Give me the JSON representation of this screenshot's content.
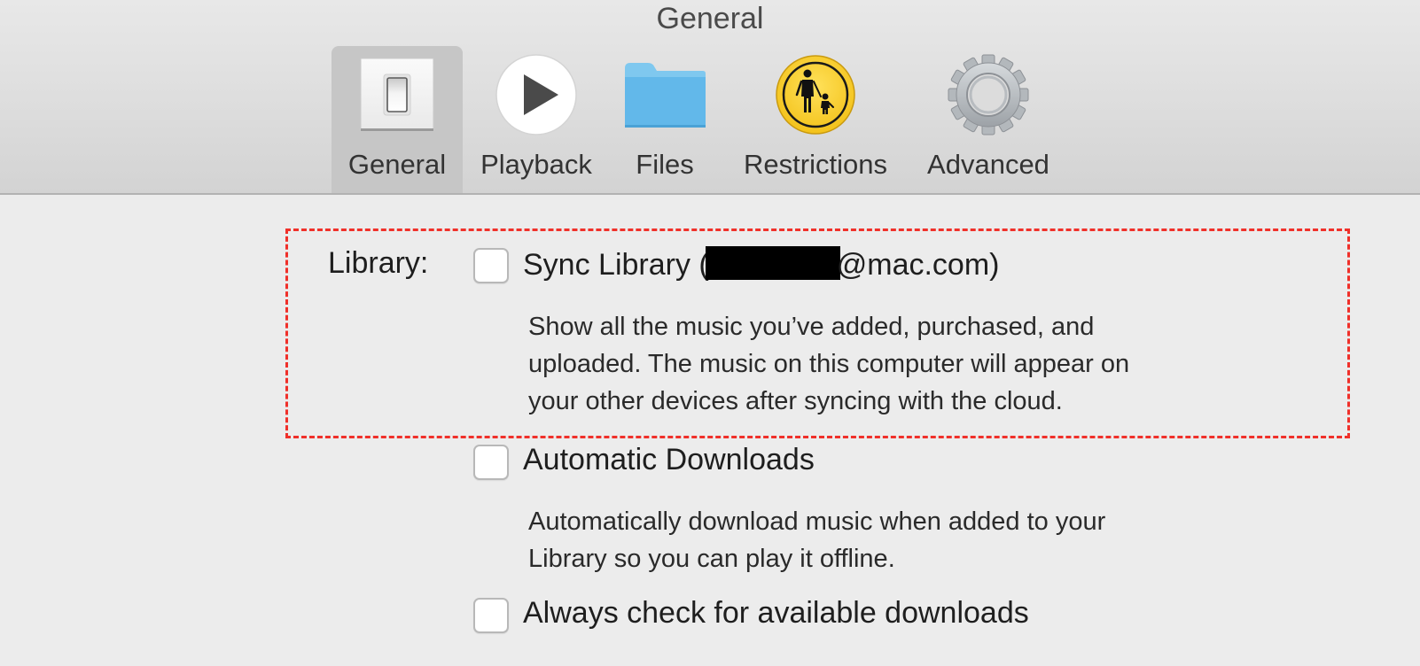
{
  "window": {
    "title": "General"
  },
  "toolbar": {
    "tabs": [
      {
        "label": "General",
        "icon": "light-switch-icon",
        "selected": true
      },
      {
        "label": "Playback",
        "icon": "play-icon",
        "selected": false
      },
      {
        "label": "Files",
        "icon": "folder-icon",
        "selected": false
      },
      {
        "label": "Restrictions",
        "icon": "parental-restrictions-icon",
        "selected": false
      },
      {
        "label": "Advanced",
        "icon": "gear-icon",
        "selected": false
      }
    ]
  },
  "library": {
    "section_label": "Library:",
    "sync_library": {
      "label_prefix": "Sync Library (",
      "email_suffix": "@mac.com)",
      "checked": false,
      "description": [
        "Show all the music you’ve added, purchased, and",
        "uploaded. The music on this computer will appear on",
        "your other devices after syncing with the cloud."
      ]
    },
    "automatic_downloads": {
      "label": "Automatic Downloads",
      "checked": false,
      "description": [
        "Automatically download music when added to your",
        "Library so you can play it offline."
      ]
    },
    "always_check": {
      "label": "Always check for available downloads",
      "checked": false
    }
  },
  "annotation": {
    "color": "#f0302a",
    "style": "dashed"
  }
}
